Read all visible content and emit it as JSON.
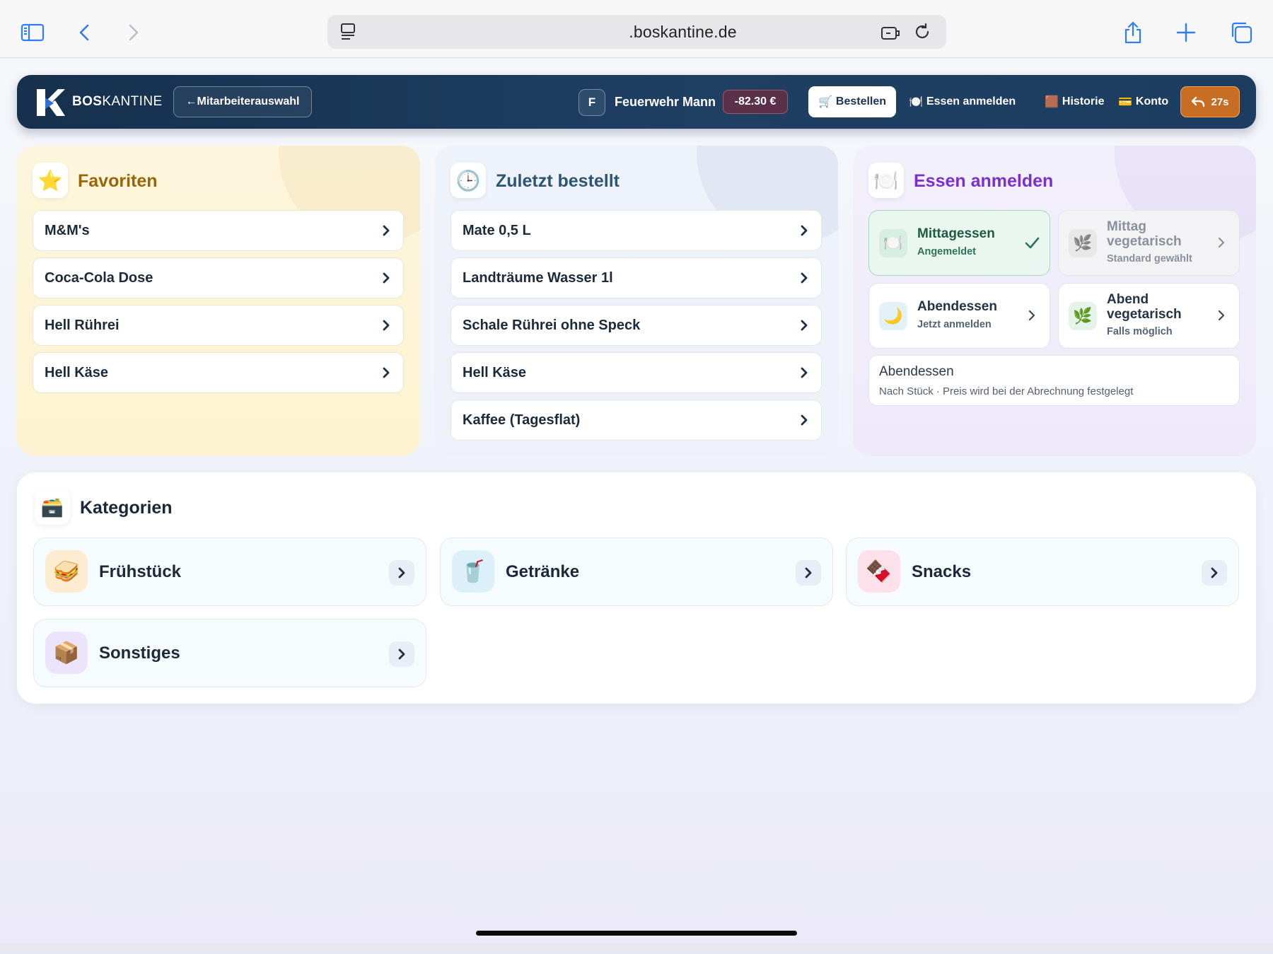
{
  "browser": {
    "url": ".boskantine.de",
    "icons": [
      "sidebar-icon",
      "back-icon",
      "forward-icon",
      "reader-icon",
      "extension-icon",
      "reload-icon",
      "share-icon",
      "new-tab-icon",
      "tabs-icon"
    ]
  },
  "nav": {
    "logo_bold": "BOS",
    "logo_light": "KANTINE",
    "back_label": "←Mitarbeiterauswahl",
    "user_initial": "F",
    "user_name": "Feuerwehr Mann",
    "balance": "-82.30 €",
    "tabs": [
      {
        "icon": "🛒",
        "label": "Bestellen",
        "active": true
      },
      {
        "icon": "🍽️",
        "label": "Essen anmelden"
      },
      {
        "icon": "🟫",
        "label": "Historie"
      },
      {
        "icon": "💳",
        "label": "Konto"
      }
    ],
    "timer": "27s",
    "accent": "#c76e24"
  },
  "favorites": {
    "icon": "⭐",
    "title": "Favoriten",
    "items": [
      "M&M's",
      "Coca-Cola Dose",
      "Hell Rührei",
      "Hell Käse"
    ]
  },
  "recent": {
    "icon": "🕒",
    "title": "Zuletzt bestellt",
    "items": [
      "Mate 0,5 L",
      "Landträume Wasser 1l",
      "Schale Rührei ohne Speck",
      "Hell Käse",
      "Kaffee (Tagesflat)"
    ]
  },
  "meal_signup": {
    "icon": "🍽️",
    "title": "Essen anmelden",
    "cards": [
      {
        "icon": "🍽️",
        "title": "Mittagessen",
        "sub": "Angemeldet",
        "state": "checked"
      },
      {
        "icon": "🌿",
        "title": "Mittag vegetarisch",
        "sub": "Standard gewählt",
        "state": "muted"
      },
      {
        "icon": "🌙",
        "title": "Abendessen",
        "sub": "Jetzt anmelden",
        "state": "open"
      },
      {
        "icon": "🌿",
        "title": "Abend vegetarisch",
        "sub": "Falls möglich",
        "state": "open"
      }
    ],
    "note": {
      "title": "Abendessen",
      "sub": "Nach Stück · Preis wird bei der Abrechnung festgelegt"
    }
  },
  "categories": {
    "icon": "🗃️",
    "title": "Kategorien",
    "items": [
      {
        "icon": "🥪",
        "label": "Frühstück",
        "color": "#fdeccf"
      },
      {
        "icon": "🥤",
        "label": "Getränke",
        "color": "#dcf0fa"
      },
      {
        "icon": "🍫",
        "label": "Snacks",
        "color": "#fce1ea"
      },
      {
        "icon": "📦",
        "label": "Sonstiges",
        "color": "#ece4fb"
      }
    ]
  }
}
